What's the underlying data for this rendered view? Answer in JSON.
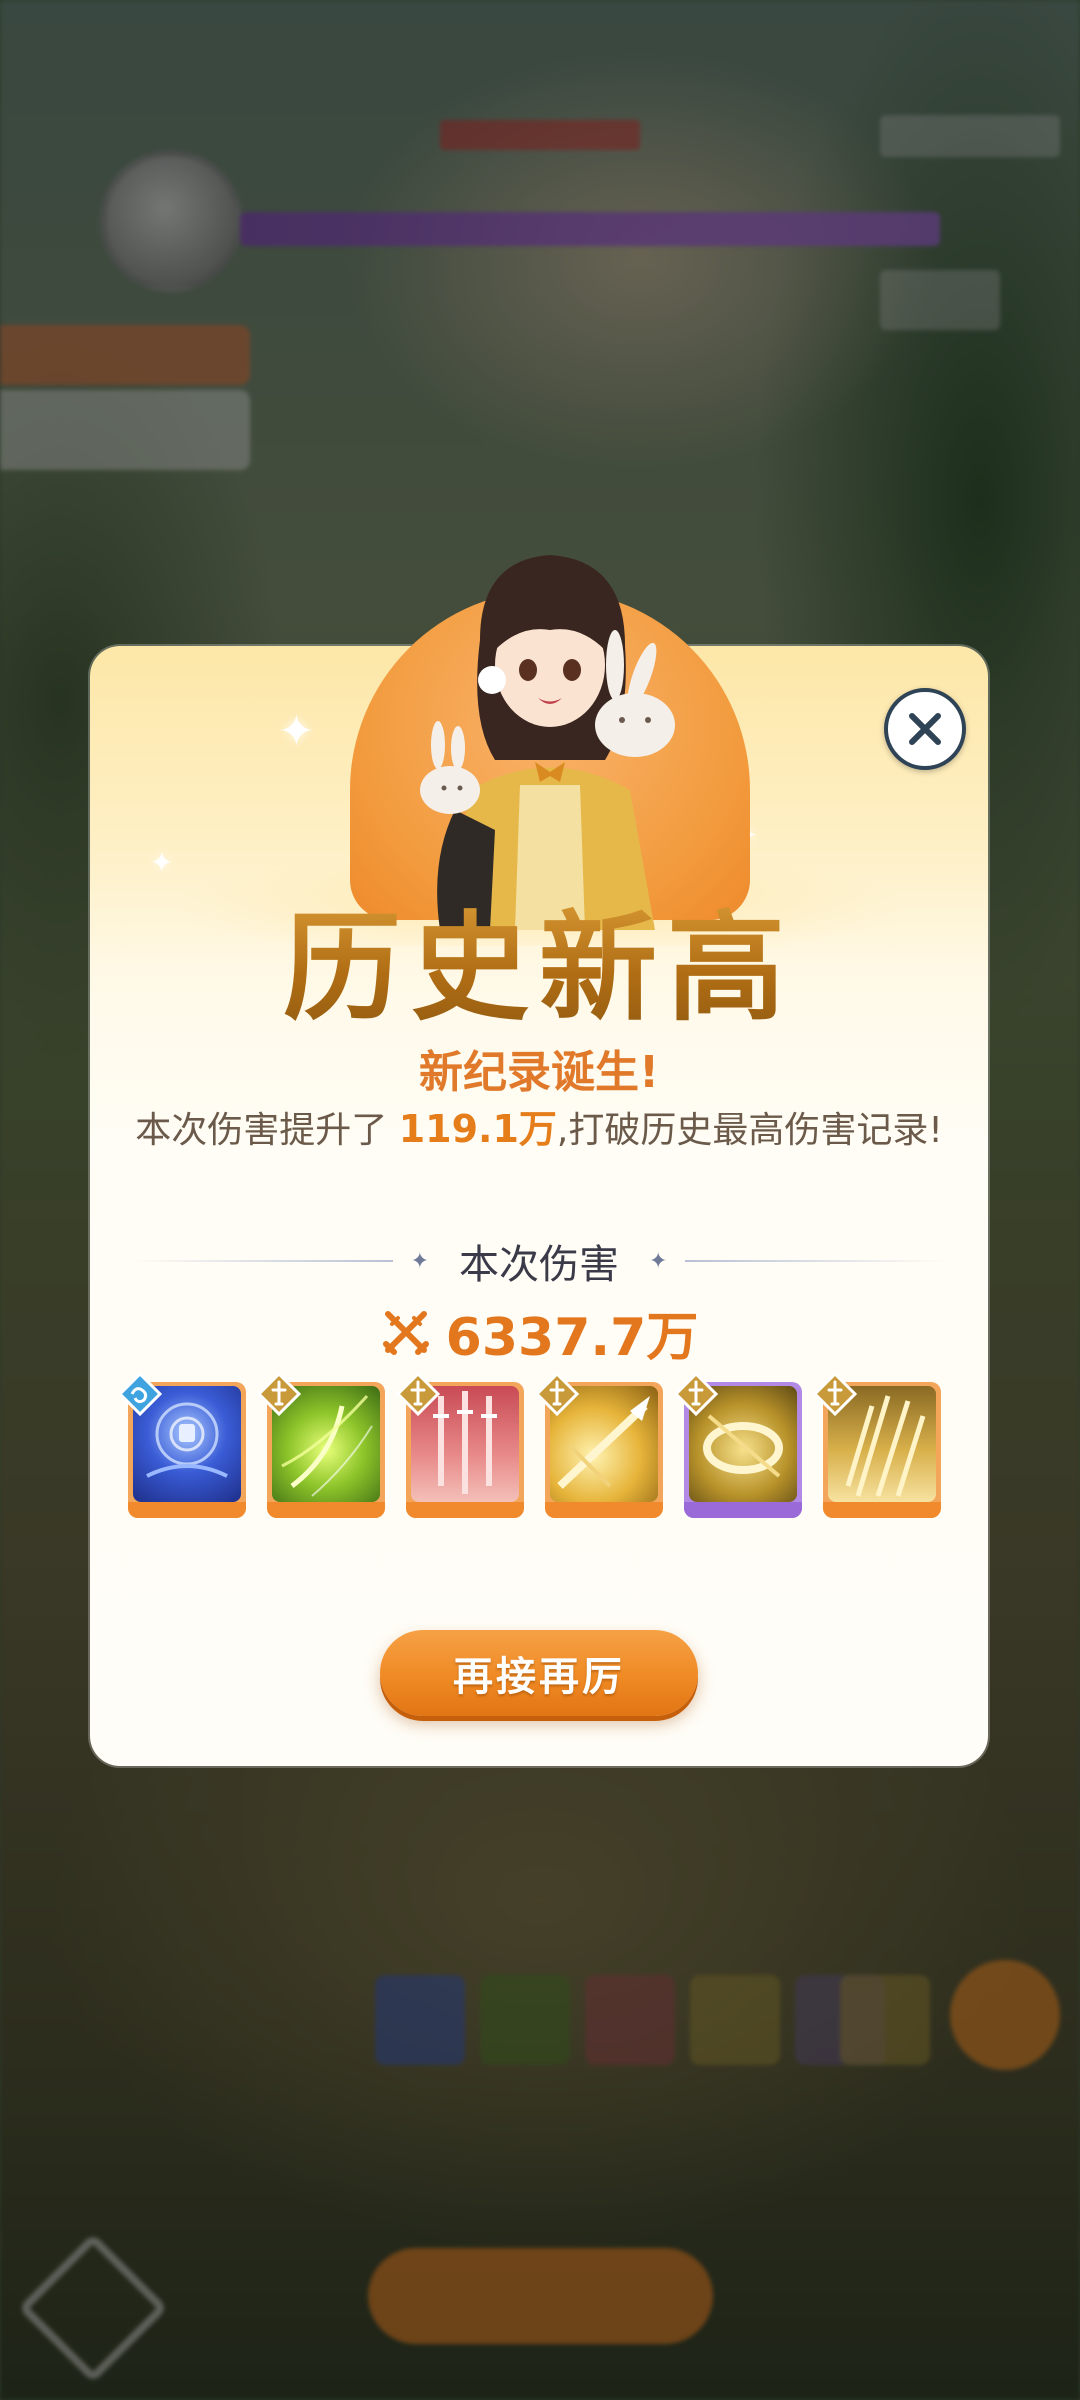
{
  "dialog": {
    "headline": "历史新高",
    "subtitle": "新纪录诞生!",
    "description_prefix": "本次伤害提升了",
    "description_increase": "119.1万",
    "description_suffix": ",打破历史最高伤害记录!",
    "section_title": "本次伤害",
    "damage_value": "6337.7万",
    "retry_label": "再接再厉"
  },
  "skills": [
    {
      "name": "frost-vortex",
      "element": "water",
      "frame": "orange"
    },
    {
      "name": "wind-slash",
      "element": "sword",
      "frame": "orange"
    },
    {
      "name": "blade-rain",
      "element": "sword",
      "frame": "orange"
    },
    {
      "name": "golden-lance",
      "element": "sword",
      "frame": "orange"
    },
    {
      "name": "golden-ring",
      "element": "sword",
      "frame": "purple"
    },
    {
      "name": "sword-burst",
      "element": "sword",
      "frame": "orange"
    }
  ],
  "colors": {
    "accent": "#ef8a24",
    "damage_text": "#e3771e",
    "headline_gold": "#b57a1c",
    "frame_orange": "#f3a55a",
    "frame_purple": "#b28ae6"
  },
  "icons": {
    "close": "close-icon",
    "damage": "crossed-swords-icon",
    "element_water": "water-element-icon",
    "element_sword": "sword-element-icon"
  }
}
